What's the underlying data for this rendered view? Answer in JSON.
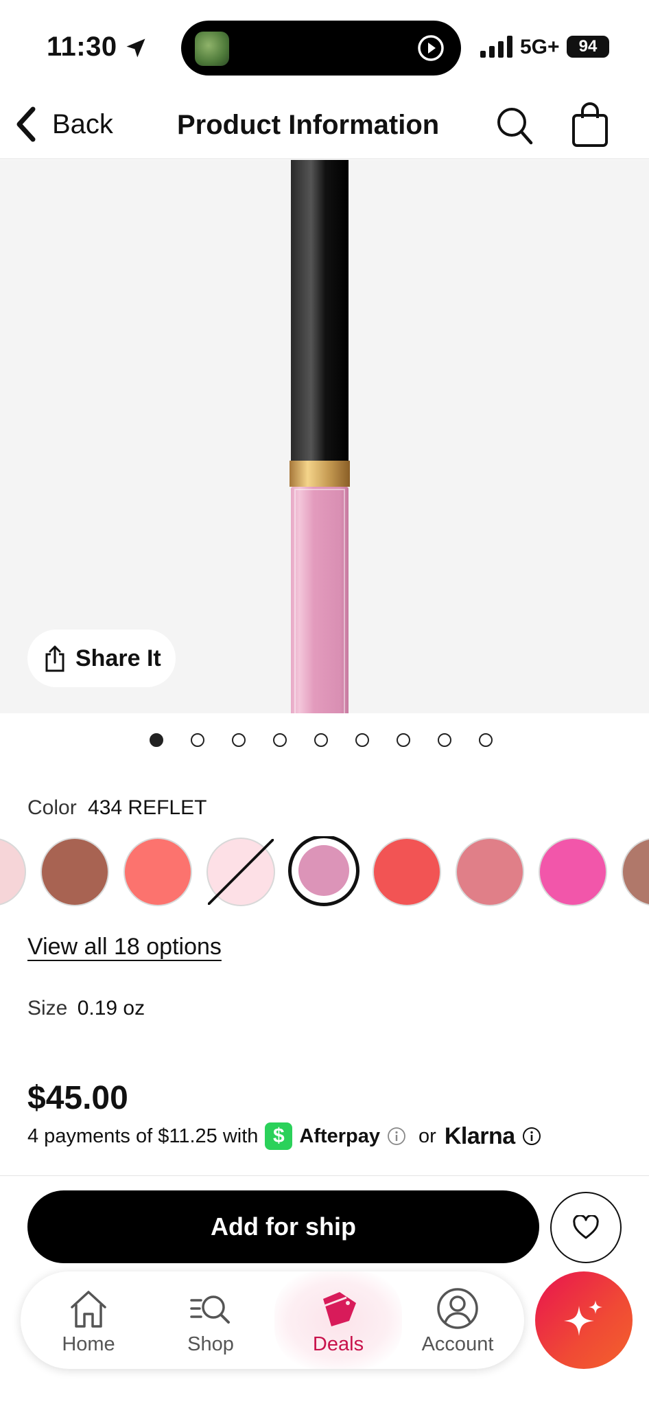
{
  "status_bar": {
    "time": "11:30",
    "network": "5G+",
    "battery": "94"
  },
  "header": {
    "back_label": "Back",
    "title": "Product Information"
  },
  "product": {
    "share_label": "Share It",
    "image_count": 9,
    "active_image_index": 0,
    "color_label": "Color",
    "color_value": "434 REFLET",
    "swatches": [
      {
        "color": "#f6d5d8",
        "state": "available"
      },
      {
        "color": "#a86352",
        "state": "available"
      },
      {
        "color": "#fc736e",
        "state": "available"
      },
      {
        "color": "#fde0e6",
        "state": "unavailable"
      },
      {
        "color": "#dc94b8",
        "state": "selected"
      },
      {
        "color": "#f25454",
        "state": "available"
      },
      {
        "color": "#e07f88",
        "state": "available"
      },
      {
        "color": "#f256aa",
        "state": "available"
      },
      {
        "color": "#b0786a",
        "state": "available"
      }
    ],
    "view_all_label": "View all 18 options",
    "size_label": "Size",
    "size_value": "0.19 oz",
    "price": "$45.00",
    "payments_text": "4 payments of $11.25 with",
    "afterpay_label": "Afterpay",
    "or_label": "or",
    "klarna_label": "Klarna"
  },
  "actions": {
    "add_label": "Add for ship"
  },
  "tab_bar": {
    "tabs": [
      {
        "label": "Home",
        "icon": "home-icon"
      },
      {
        "label": "Shop",
        "icon": "shop-search-icon"
      },
      {
        "label": "Deals",
        "icon": "deals-tag-icon",
        "active": true
      },
      {
        "label": "Account",
        "icon": "account-icon"
      }
    ]
  },
  "colors": {
    "accent": "#c8124b",
    "primary_button": "#000000",
    "ai_button_gradient": [
      "#e8144f",
      "#f3622c"
    ]
  }
}
